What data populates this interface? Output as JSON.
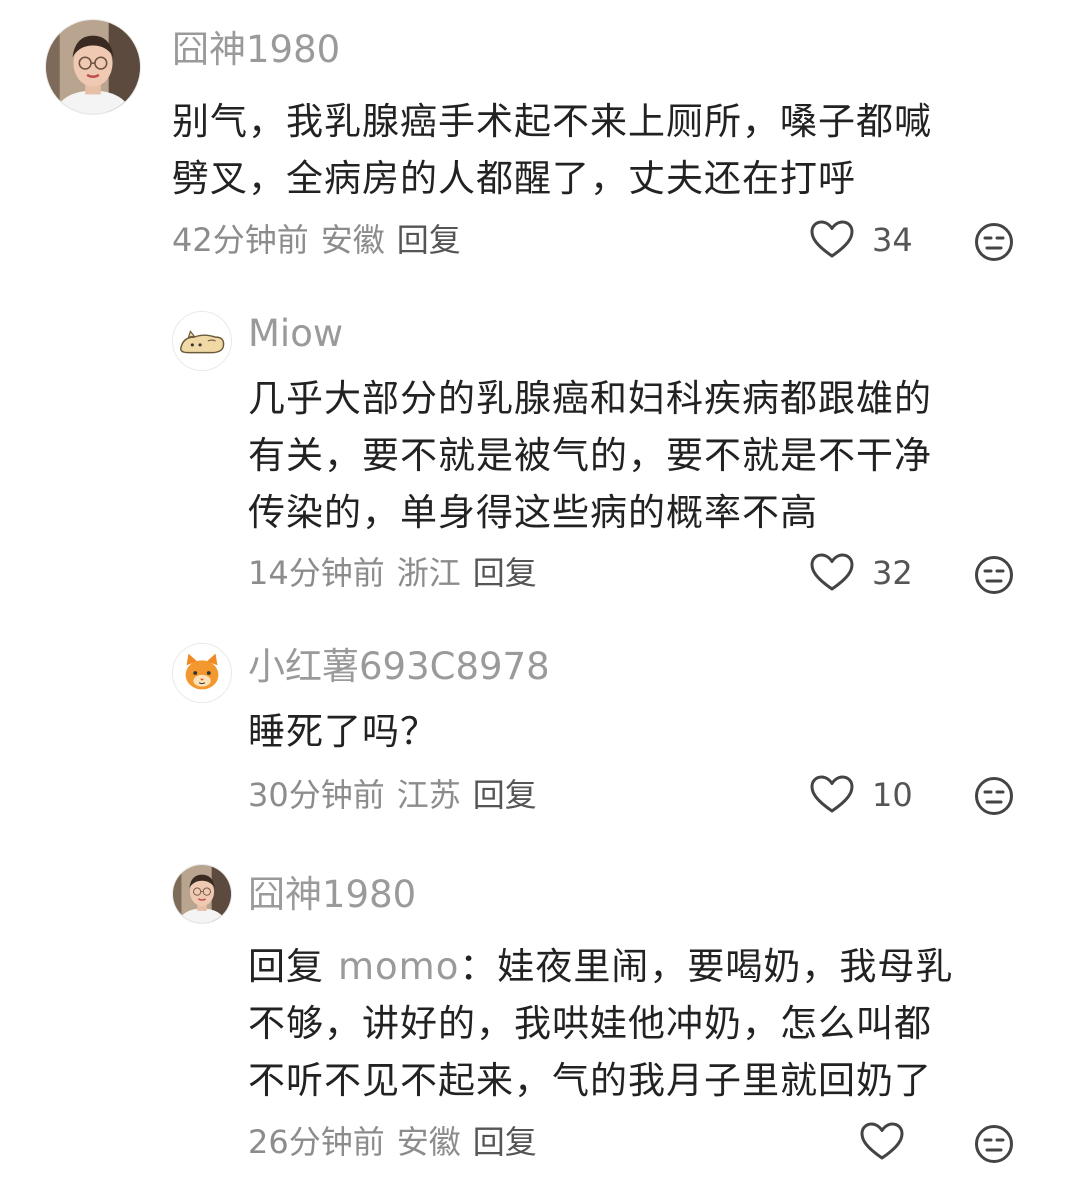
{
  "comments": [
    {
      "username": "囧神1980",
      "text_lines": [
        "别气，我乳腺癌手术起不来上厕所，嗓子都喊",
        "劈叉，全病房的人都醒了，丈夫还在打呼"
      ],
      "time": "42分钟前",
      "location": "安徽",
      "reply_label": "回复",
      "likes": "34",
      "avatar_icon": "woman-portrait-avatar"
    },
    {
      "username": "Miow",
      "text_lines": [
        "几乎大部分的乳腺癌和妇科疾病都跟雄的",
        "有关，要不就是被气的，要不就是不干净",
        "传染的，单身得这些病的概率不高"
      ],
      "time": "14分钟前",
      "location": "浙江",
      "reply_label": "回复",
      "likes": "32",
      "avatar_icon": "bread-cat-avatar"
    },
    {
      "username": "小红薯693C8978",
      "text_lines": [
        "睡死了吗？"
      ],
      "time": "30分钟前",
      "location": "江苏",
      "reply_label": "回复",
      "likes": "10",
      "avatar_icon": "orange-cat-avatar"
    },
    {
      "username": "囧神1980",
      "reply_prefix": "回复",
      "reply_target": "momo",
      "text_lines": [
        "：娃夜里闹，要喝奶，我母乳",
        "不够，讲好的，我哄娃他冲奶，怎么叫都",
        "不听不见不起来，气的我月子里就回奶了"
      ],
      "time": "26分钟前",
      "location": "安徽",
      "reply_label": "回复",
      "likes": "",
      "avatar_icon": "woman-portrait-avatar"
    }
  ],
  "colors": {
    "username": "#9a9a9a",
    "text": "#222222",
    "meta": "#8c8c8c",
    "icon_stroke": "#444444"
  }
}
